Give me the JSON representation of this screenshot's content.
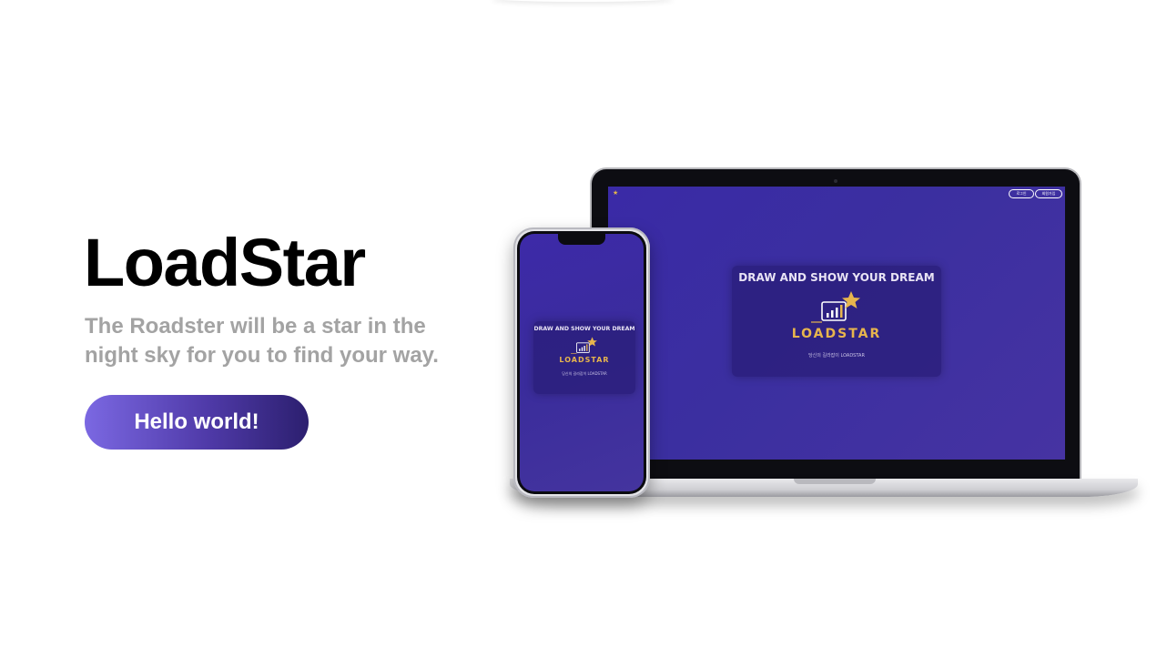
{
  "hero": {
    "title": "LoadStar",
    "subtitle": "The Roadster will be a star in the night sky for you to find your way.",
    "cta_label": "Hello world!"
  },
  "mockup": {
    "laptop": {
      "nav_login": "로그인",
      "nav_signup": "회원가입",
      "heading": "DRAW AND SHOW YOUR DREAM",
      "brand": "LOADSTAR",
      "tagline": "당신의 길라잡이 LOADSTAR"
    },
    "phone": {
      "heading": "DRAW AND SHOW YOUR DREAM",
      "brand": "LOADSTAR",
      "tagline": "당신의 길라잡이 LOADSTAR"
    }
  },
  "colors": {
    "title": "#000000",
    "subtitle": "#a3a3a3",
    "cta_gradient_start": "#7b68e2",
    "cta_gradient_end": "#2c1f6f",
    "screen_purple": "#3a2aa6",
    "brand_gold": "#e7b54d"
  },
  "icons": [
    "star-chart-logo-icon"
  ]
}
